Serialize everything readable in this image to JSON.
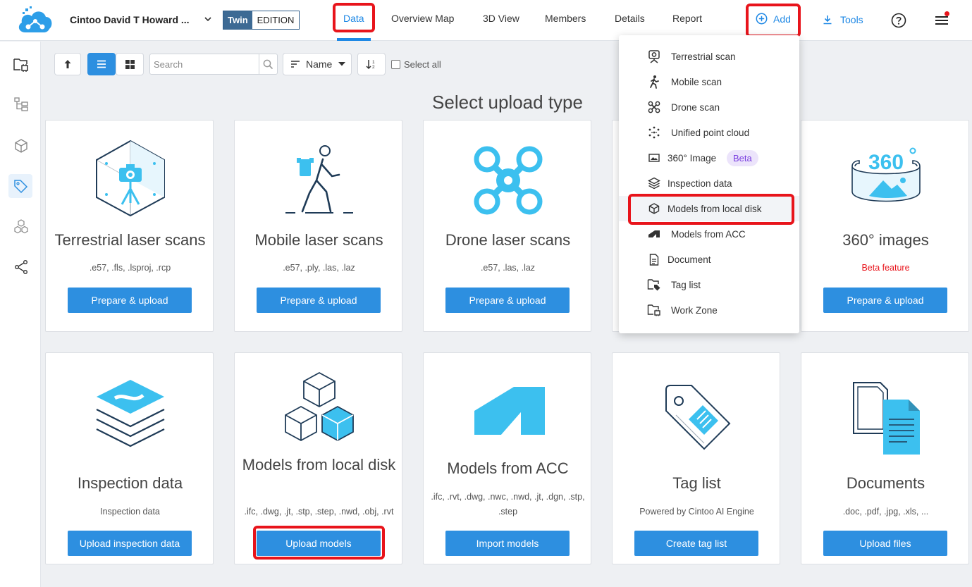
{
  "header": {
    "project_name": "Cintoo David T Howard ...",
    "edition_twin": "Twin",
    "edition_label": "EDITION",
    "nav": [
      "Data",
      "Overview Map",
      "3D View",
      "Members",
      "Details",
      "Report"
    ],
    "add_label": "Add",
    "tools_label": "Tools"
  },
  "toolbar": {
    "search_placeholder": "Search",
    "sort_label": "Name",
    "select_all_label": "Select all"
  },
  "page_title": "Select upload type",
  "cards": [
    {
      "title": "Terrestrial laser scans",
      "sub": ".e57, .fls, .lsproj, .rcp",
      "button": "Prepare & upload"
    },
    {
      "title": "Mobile laser scans",
      "sub": ".e57, .ply, .las, .laz",
      "button": "Prepare & upload"
    },
    {
      "title": "Drone laser scans",
      "sub": ".e57, .las, .laz",
      "button": "Prepare & upload"
    },
    {
      "title": "360° images",
      "sub": "Beta feature",
      "button": "Prepare & upload"
    },
    {
      "title": "Inspection data",
      "sub": "Inspection data",
      "button": "Upload inspection data"
    },
    {
      "title": "Models from local disk",
      "sub": ".ifc, .dwg, .jt, .stp, .step, .nwd, .obj, .rvt",
      "button": "Upload models"
    },
    {
      "title": "Models from ACC",
      "sub": ".ifc, .rvt, .dwg, .nwc, .nwd, .jt, .dgn, .stp, .step",
      "button": "Import models"
    },
    {
      "title": "Tag list",
      "sub": "Powered by Cintoo AI Engine",
      "button": "Create tag list"
    },
    {
      "title": "Documents",
      "sub": ".doc, .pdf, .jpg, .xls, ...",
      "button": "Upload files"
    }
  ],
  "dropdown": {
    "items": [
      {
        "label": "Terrestrial scan",
        "icon": "terrestrial-scan-icon"
      },
      {
        "label": "Mobile scan",
        "icon": "walking-person-icon"
      },
      {
        "label": "Drone scan",
        "icon": "drone-icon"
      },
      {
        "label": "Unified point cloud",
        "icon": "point-cloud-icon"
      },
      {
        "label": "360° Image",
        "icon": "panorama-icon"
      },
      {
        "label": "Inspection data",
        "icon": "layers-icon"
      },
      {
        "label": "Models from local disk",
        "icon": "cube-icon"
      },
      {
        "label": "Models from ACC",
        "icon": "acc-icon"
      },
      {
        "label": "Document",
        "icon": "document-icon"
      },
      {
        "label": "Tag list",
        "icon": "tag-folder-icon"
      },
      {
        "label": "Work Zone",
        "icon": "workzone-folder-icon"
      }
    ],
    "beta_label": "Beta"
  },
  "colors": {
    "accent": "#1e88e5",
    "highlight": "#e8141b",
    "icon_fill": "#3cc0ef",
    "icon_stroke": "#1f3b57"
  }
}
